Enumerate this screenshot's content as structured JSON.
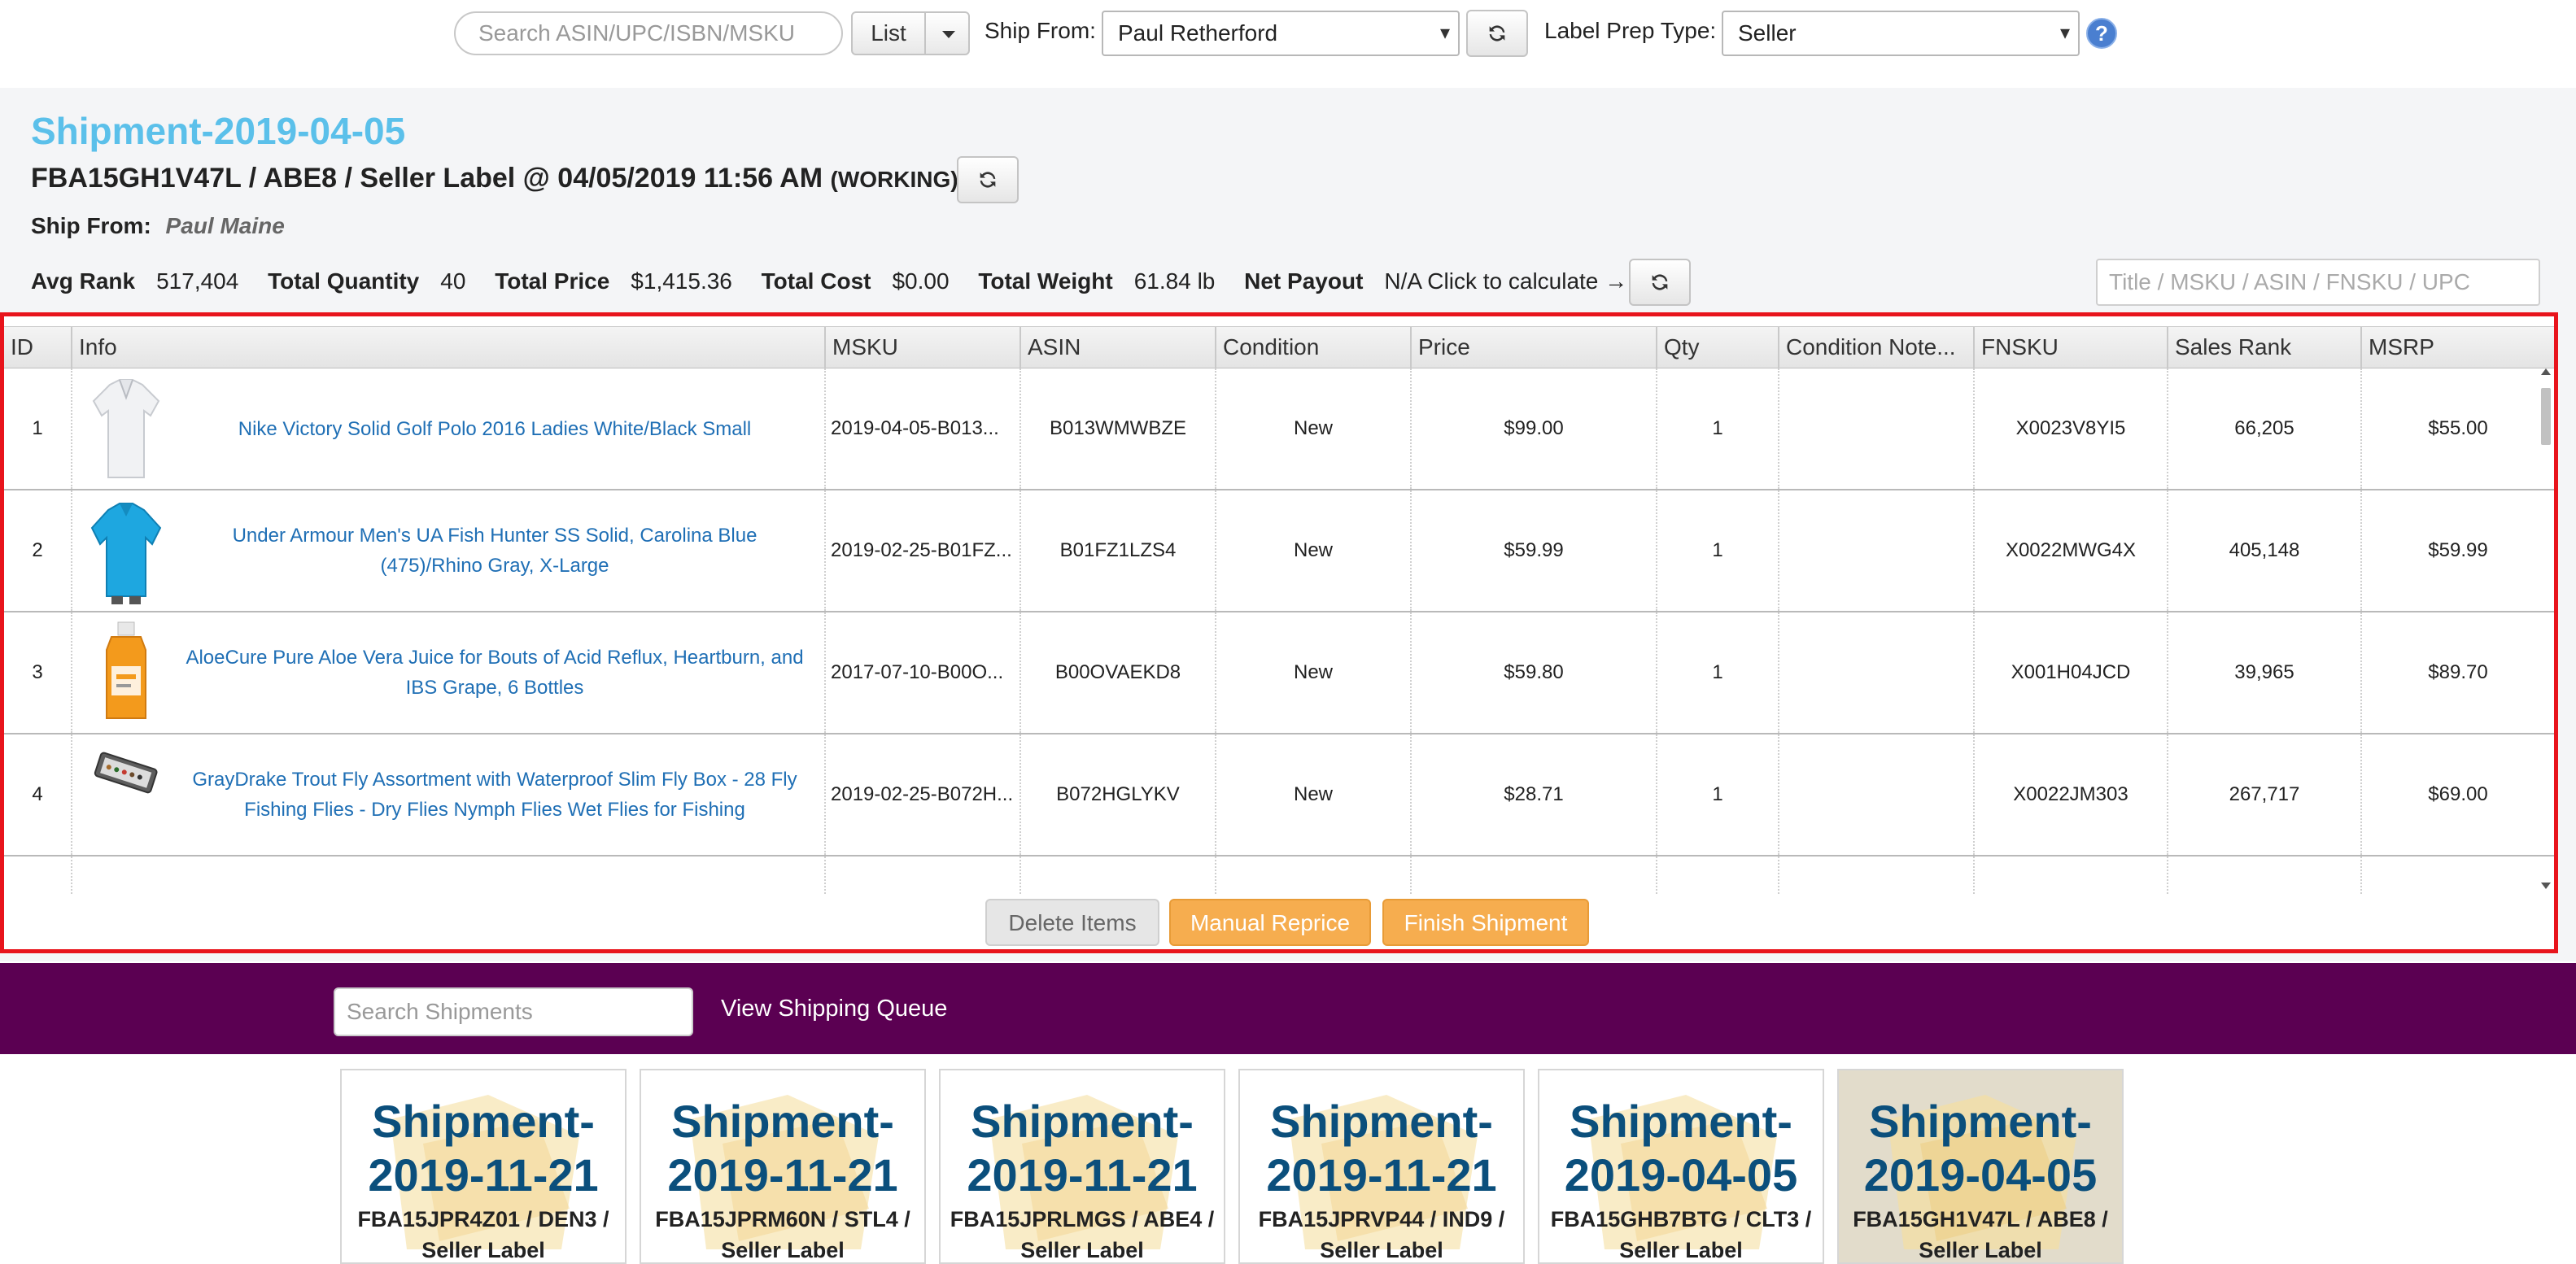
{
  "toolbar": {
    "search_placeholder": "Search ASIN/UPC/ISBN/MSKU",
    "list_label": "List",
    "ship_from_label": "Ship From:",
    "ship_from_value": "Paul Retherford",
    "label_prep_label": "Label Prep Type:",
    "label_prep_value": "Seller",
    "help_label": "?"
  },
  "shipment": {
    "title": "Shipment-2019-04-05",
    "subtitle": "FBA15GH1V47L / ABE8 / Seller Label @ 04/05/2019 11:56 AM",
    "status": "(WORKING)",
    "ship_from_label": "Ship From:",
    "ship_from_value": "Paul Maine",
    "stats": [
      {
        "label": "Avg Rank",
        "value": "517,404"
      },
      {
        "label": "Total Quantity",
        "value": "40"
      },
      {
        "label": "Total Price",
        "value": "$1,415.36"
      },
      {
        "label": "Total Cost",
        "value": "$0.00"
      },
      {
        "label": "Total Weight",
        "value": "61.84 lb"
      },
      {
        "label": "Net Payout",
        "value": "N/A Click to calculate →"
      }
    ],
    "filter_placeholder": "Title / MSKU / ASIN / FNSKU / UPC"
  },
  "grid": {
    "columns": [
      "ID",
      "Info",
      "MSKU",
      "ASIN",
      "Condition",
      "Price",
      "Qty",
      "Condition Note...",
      "FNSKU",
      "Sales Rank",
      "MSRP"
    ],
    "rows": [
      {
        "id": "1",
        "info": "Nike Victory Solid Golf Polo 2016 Ladies White/Black Small",
        "msku": "2019-04-05-B013...",
        "asin": "B013WMWBZE",
        "condition": "New",
        "price": "$99.00",
        "qty": "1",
        "note": "",
        "fnsku": "X0023V8YI5",
        "rank": "66,205",
        "msrp": "$55.00",
        "thumb_icon": "white-polo-shirt-icon"
      },
      {
        "id": "2",
        "info": "Under Armour Men's UA Fish Hunter SS Solid, Carolina Blue (475)/Rhino Gray, X-Large",
        "msku": "2019-02-25-B01FZ...",
        "asin": "B01FZ1LZS4",
        "condition": "New",
        "price": "$59.99",
        "qty": "1",
        "note": "",
        "fnsku": "X0022MWG4X",
        "rank": "405,148",
        "msrp": "$59.99",
        "thumb_icon": "blue-shirt-icon"
      },
      {
        "id": "3",
        "info": "AloeCure Pure Aloe Vera Juice for Bouts of Acid Reflux, Heartburn, and IBS Grape, 6 Bottles",
        "msku": "2017-07-10-B00O...",
        "asin": "B00OVAEKD8",
        "condition": "New",
        "price": "$59.80",
        "qty": "1",
        "note": "",
        "fnsku": "X001H04JCD",
        "rank": "39,965",
        "msrp": "$89.70",
        "thumb_icon": "juice-bottle-icon"
      },
      {
        "id": "4",
        "info": "GrayDrake Trout Fly Assortment with Waterproof Slim Fly Box - 28 Fly Fishing Flies - Dry Flies Nymph Flies Wet Flies for Fishing",
        "msku": "2019-02-25-B072H...",
        "asin": "B072HGLYKV",
        "condition": "New",
        "price": "$28.71",
        "qty": "1",
        "note": "",
        "fnsku": "X0022JM303",
        "rank": "267,717",
        "msrp": "$69.00",
        "thumb_icon": "fly-box-icon"
      }
    ],
    "actions": {
      "delete": "Delete Items",
      "reprice": "Manual Reprice",
      "finish": "Finish Shipment"
    }
  },
  "nav": {
    "search_placeholder": "Search Shipments",
    "queue_link": "View Shipping Queue"
  },
  "cards": [
    {
      "title": "Shipment-2019-11-21",
      "sub1": "FBA15JPR4Z01 / DEN3 /",
      "sub2": "Seller Label"
    },
    {
      "title": "Shipment-2019-11-21",
      "sub1": "FBA15JPRM60N / STL4 /",
      "sub2": "Seller Label"
    },
    {
      "title": "Shipment-2019-11-21",
      "sub1": "FBA15JPRLMGS / ABE4 /",
      "sub2": "Seller Label"
    },
    {
      "title": "Shipment-2019-11-21",
      "sub1": "FBA15JPRVP44 / IND9 /",
      "sub2": "Seller Label"
    },
    {
      "title": "Shipment-2019-04-05",
      "sub1": "FBA15GHB7BTG / CLT3 /",
      "sub2": "Seller Label"
    },
    {
      "title": "Shipment-2019-04-05",
      "sub1": "FBA15GH1V47L / ABE8 /",
      "sub2": "Seller Label"
    }
  ],
  "colors": {
    "title_blue": "#5bc0ea",
    "link_blue": "#1f6fb5",
    "action_orange": "#f6ad4f",
    "nav_purple": "#5b0052",
    "card_title": "#0b4f7c",
    "highlight_border": "#e8141c"
  }
}
